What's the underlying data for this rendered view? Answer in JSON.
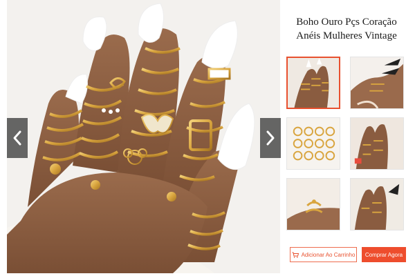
{
  "product": {
    "title_line1": "Boho Ouro Pçs Coração",
    "title_line2": "Anéis Mulheres Vintage"
  },
  "gallery": {
    "prev_icon": "chevron-left-icon",
    "next_icon": "chevron-right-icon",
    "selected_index": 0,
    "thumbnail_count": 6
  },
  "actions": {
    "add_to_cart_label": "Adicionar Ao Carrinho",
    "buy_now_label": "Comprar Agora"
  },
  "colors": {
    "accent": "#ee4d2d",
    "gold": "#d9a53f"
  }
}
